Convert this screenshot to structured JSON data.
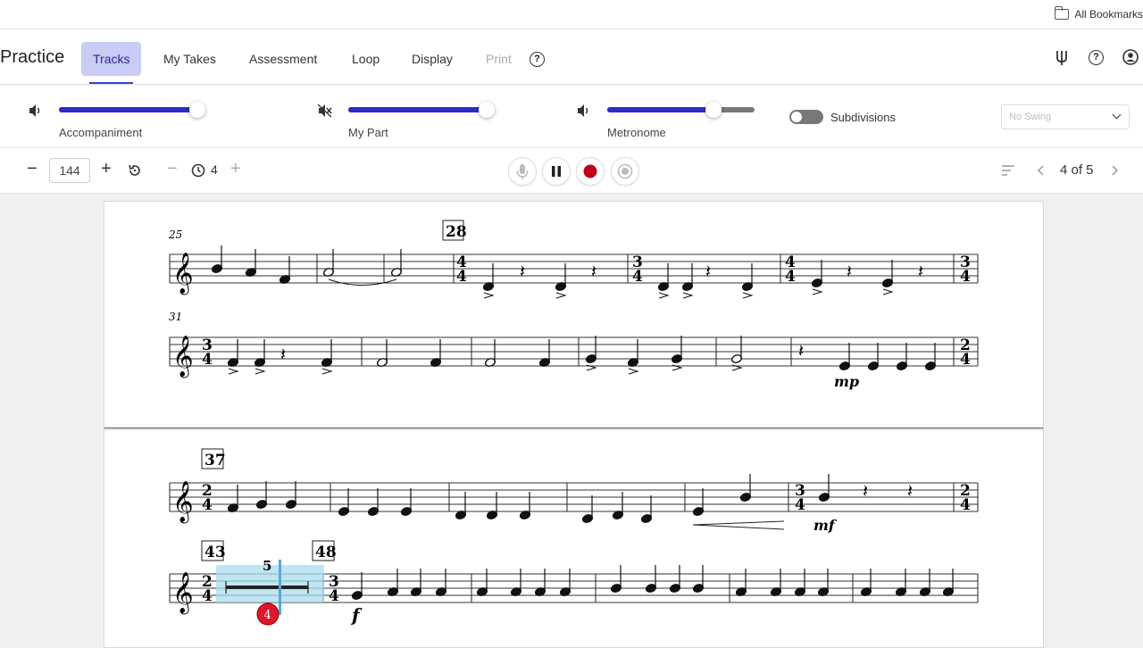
{
  "bookmarks": {
    "all_bookmarks": "All Bookmarks"
  },
  "nav": {
    "title": "Practice",
    "tabs": [
      {
        "label": "Tracks",
        "state": "active"
      },
      {
        "label": "My Takes",
        "state": "normal"
      },
      {
        "label": "Assessment",
        "state": "normal"
      },
      {
        "label": "Loop",
        "state": "normal"
      },
      {
        "label": "Display",
        "state": "normal"
      },
      {
        "label": "Print",
        "state": "disabled"
      }
    ]
  },
  "mixer": {
    "accompaniment": {
      "label": "Accompaniment",
      "volume": 0.96,
      "muted": false
    },
    "my_part": {
      "label": "My Part",
      "volume": 0.96,
      "muted": true
    },
    "metronome": {
      "label": "Metronome",
      "volume": 0.72,
      "muted": false
    },
    "subdivisions": {
      "label": "Subdivisions",
      "on": false
    },
    "swing": {
      "value": "No Swing"
    }
  },
  "controls": {
    "tempo": "144",
    "count_in": "4",
    "page_indicator": "4 of 5"
  },
  "score": {
    "measure_numbers": [
      "25",
      "28",
      "31",
      "37",
      "43",
      "48"
    ],
    "multirest_count": "5",
    "cursor_badge": "4",
    "dynamics": [
      "mp",
      "mf",
      "f"
    ],
    "time_signatures": [
      "4/4",
      "3/4",
      "2/4"
    ]
  },
  "colors": {
    "accent": "#2c2cc6",
    "active_tab": "#c9ccf5",
    "record": "#c0001a",
    "loop_highlight": "#a9dcef"
  }
}
